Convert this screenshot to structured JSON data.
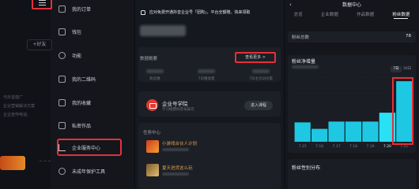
{
  "profile": {
    "add_friend": "+好友",
    "faint_lines": [
      "与抖音建广",
      "企业营销解决方案",
      "企业宣传电话。"
    ],
    "nav_items": [
      {
        "label": "我的订单",
        "icon": "order-icon"
      },
      {
        "label": "钱包",
        "icon": "wallet-icon"
      },
      {
        "label": "功能",
        "icon": "link-icon"
      },
      {
        "label": "我的二维码",
        "icon": "qrcode-icon"
      },
      {
        "label": "我的收藏",
        "icon": "bookmark-icon"
      },
      {
        "label": "私密作品",
        "icon": "lock-icon"
      },
      {
        "label": "企业服务中心",
        "icon": "chart-icon"
      },
      {
        "label": "未成年保护工具",
        "icon": "umbrella-icon"
      }
    ]
  },
  "service_center": {
    "notice": "应对免费开通抖音企业号「团购」，平台全额赠。快来领取",
    "overview_title": "数据概要",
    "view_more": "查看更多 >",
    "overview_labels": [
      "粉丝数",
      "7日播放量",
      "7日主页访问量"
    ],
    "academy_title": "企业号学院",
    "academy_sub": "学习经营抖音号技巧",
    "enter_course": "进入课程",
    "tasks_title": "任务中心",
    "tasks": [
      {
        "title": "小游戏合伙人计划"
      },
      {
        "title": "夏天进货这么玩"
      }
    ]
  },
  "data_center": {
    "header": "数据中心",
    "tabs": [
      "总览",
      "企业数据",
      "作品数据",
      "粉丝数据"
    ],
    "active_tab": 3,
    "fans_label": "粉丝总数",
    "fans_value": "78",
    "growth_title": "粉丝净增量",
    "range_options": [
      "7日",
      "30日"
    ],
    "bottom_title": "粉丝性别分布"
  },
  "chart_data": {
    "type": "bar",
    "categories": [
      "7.15",
      "7.16",
      "7.17",
      "7.18",
      "7.19",
      "7.20",
      "7.21"
    ],
    "values": [
      24,
      16,
      25,
      25,
      25,
      36,
      75
    ],
    "ylim": [
      0,
      80
    ],
    "grid": true,
    "bar_color": "#1ec8e2",
    "highlight_color": "#29e0f5",
    "highlight_index": 5
  }
}
